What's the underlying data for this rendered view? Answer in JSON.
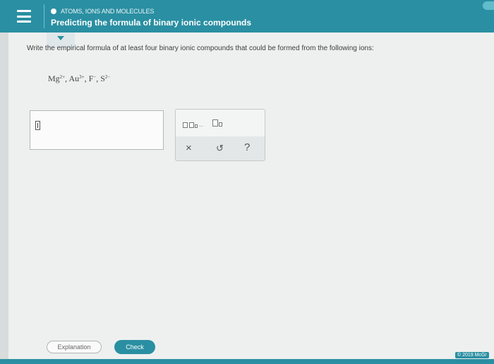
{
  "header": {
    "topic": "ATOMS, IONS AND MOLECULES",
    "title": "Predicting the formula of binary ionic compounds",
    "menu_icon": "hamburger-icon",
    "status_icon": "circle-dot-icon"
  },
  "question": {
    "prompt": "Write the empirical formula of at least four binary ionic compounds that could be formed from the following ions:",
    "ions": [
      {
        "symbol": "Mg",
        "charge": "2+"
      },
      {
        "symbol": "Au",
        "charge": "3+"
      },
      {
        "symbol": "F",
        "charge": "−"
      },
      {
        "symbol": "S",
        "charge": "2−"
      }
    ]
  },
  "palette": {
    "multi_icon": "multi-box-icon",
    "subscript_icon": "subscript-icon",
    "clear_label": "×",
    "undo_label": "↺",
    "help_label": "?"
  },
  "footer": {
    "explanation_label": "Explanation",
    "check_label": "Check",
    "copyright": "© 2019 McGr"
  },
  "colors": {
    "accent": "#2a8fa2",
    "background": "#eef0f0"
  }
}
